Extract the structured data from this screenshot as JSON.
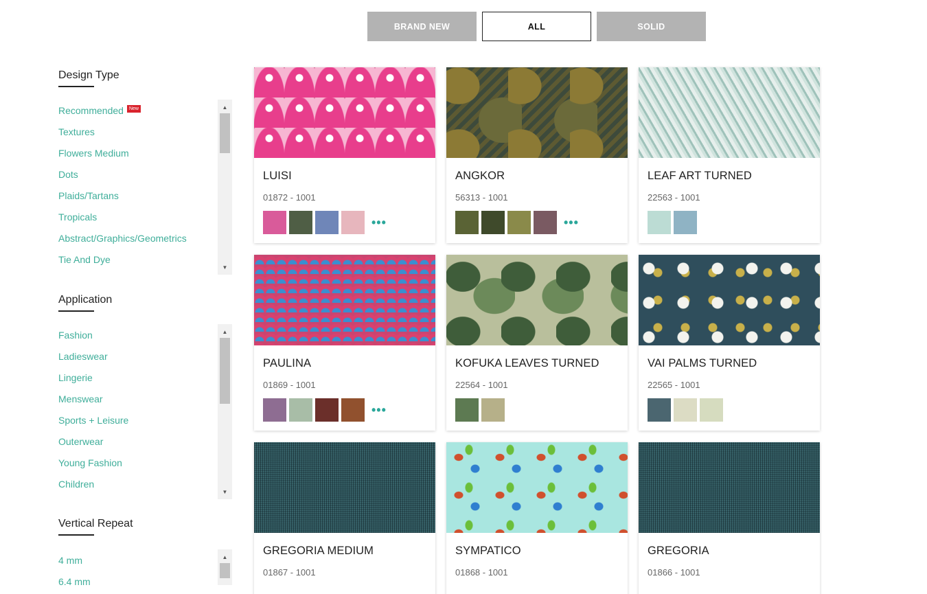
{
  "tabs": [
    {
      "label": "BRAND NEW",
      "active": false
    },
    {
      "label": "ALL",
      "active": true
    },
    {
      "label": "SOLID",
      "active": false
    }
  ],
  "sidebar": {
    "design_type": {
      "title": "Design Type",
      "items": [
        "Recommended",
        "Textures",
        "Flowers Medium",
        "Dots",
        "Plaids/Tartans",
        "Tropicals",
        "Abstract/Graphics/Geometrics",
        "Tie And Dye"
      ],
      "new_badge": "New"
    },
    "application": {
      "title": "Application",
      "items": [
        "Fashion",
        "Ladieswear",
        "Lingerie",
        "Menswear",
        "Sports + Leisure",
        "Outerwear",
        "Young Fashion",
        "Children"
      ]
    },
    "vertical_repeat": {
      "title": "Vertical Repeat",
      "items": [
        "4 mm",
        "6.4 mm"
      ]
    }
  },
  "products": [
    {
      "name": "LUISI",
      "code": "01872 - 1001",
      "more": "•••"
    },
    {
      "name": "ANGKOR",
      "code": "56313 - 1001",
      "more": "•••"
    },
    {
      "name": "LEAF ART TURNED",
      "code": "22563 - 1001",
      "more": ""
    },
    {
      "name": "PAULINA",
      "code": "01869 - 1001",
      "more": "•••"
    },
    {
      "name": "KOFUKA LEAVES TURNED",
      "code": "22564 - 1001",
      "more": ""
    },
    {
      "name": "VAI PALMS TURNED",
      "code": "22565 - 1001",
      "more": ""
    },
    {
      "name": "GREGORIA MEDIUM",
      "code": "01867 - 1001",
      "more": ""
    },
    {
      "name": "SYMPATICO",
      "code": "01868 - 1001",
      "more": ""
    },
    {
      "name": "GREGORIA",
      "code": "01866 - 1001",
      "more": ""
    }
  ],
  "colors": {
    "accent": "#3fae9a",
    "tab_inactive": "#b3b3b3",
    "badge": "#d9232d"
  }
}
